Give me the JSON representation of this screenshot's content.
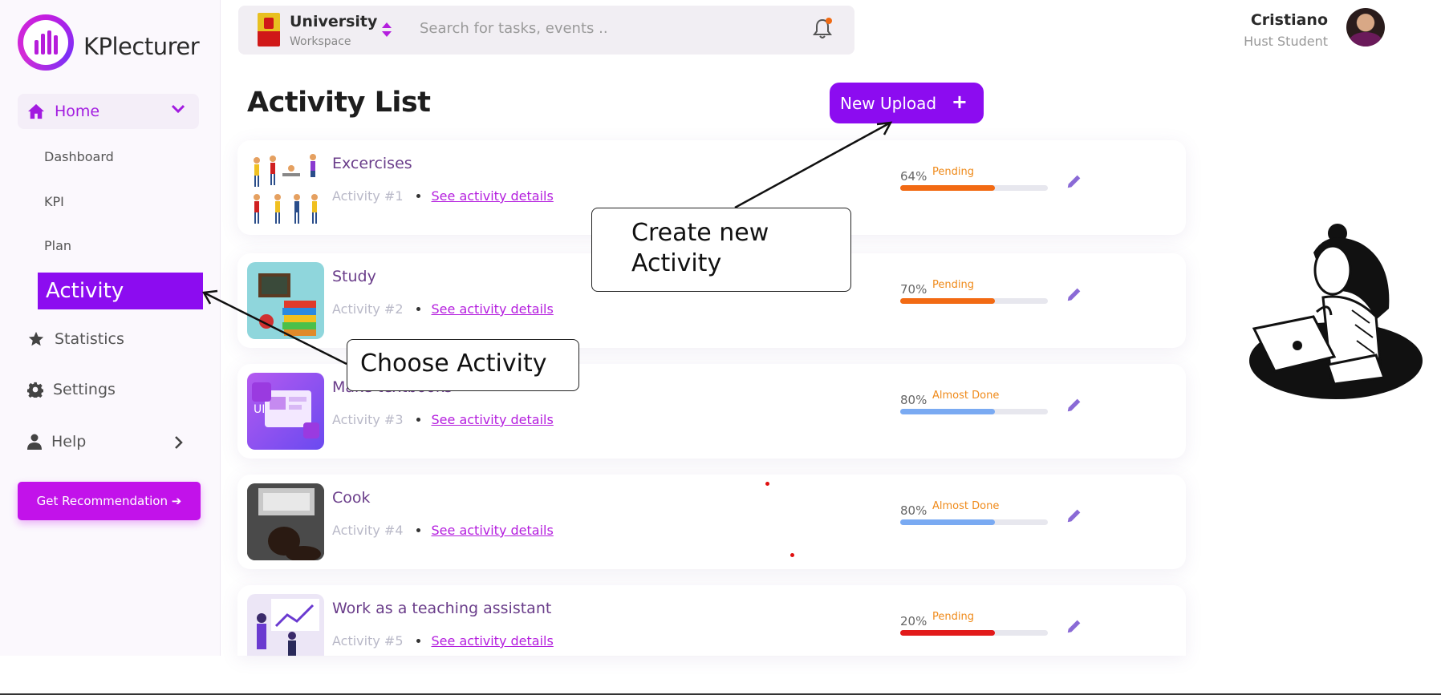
{
  "app": {
    "brand_name": "KPlecturer"
  },
  "sidebar": {
    "home_label": "Home",
    "sub_items": [
      "Dashboard",
      "KPI",
      "Plan"
    ],
    "active_item_label": "Activity",
    "items": [
      "Statistics",
      "Settings",
      "Help"
    ],
    "recommend_button": "Get Recommendation ➔",
    "accent_color": "#a21be0"
  },
  "topbar": {
    "workspace_title": "University",
    "workspace_sub": "Workspace",
    "search_placeholder": "Search for tasks, events .."
  },
  "user": {
    "name": "Cristiano",
    "role": "Hust Student"
  },
  "main": {
    "page_title": "Activity List",
    "upload_button": "New Upload",
    "upload_plus": "+",
    "link_text": "See activity details",
    "activities": [
      {
        "title": "Excercises",
        "subtitle": "Activity #1",
        "percent": "64%",
        "progress": 0.64,
        "status": "Pending",
        "bar_color": "#f26a13"
      },
      {
        "title": "Study",
        "subtitle": "Activity #2",
        "percent": "70%",
        "progress": 0.64,
        "status": "Pending",
        "bar_color": "#f26a13"
      },
      {
        "title": "Make textbooks",
        "subtitle": "Activity #3",
        "percent": "80%",
        "progress": 0.64,
        "status": "Almost Done",
        "bar_color": "#7aaaf2"
      },
      {
        "title": "Cook",
        "subtitle": "Activity #4",
        "percent": "80%",
        "progress": 0.64,
        "status": "Almost Done",
        "bar_color": "#7aaaf2"
      },
      {
        "title": "Work as a teaching assistant",
        "subtitle": "Activity #5",
        "percent": "20%",
        "progress": 0.64,
        "status": "Pending",
        "bar_color": "#e21a1a"
      }
    ]
  },
  "annotations": {
    "create_callout": "Create new Activity",
    "choose_callout": "Choose Activity"
  }
}
